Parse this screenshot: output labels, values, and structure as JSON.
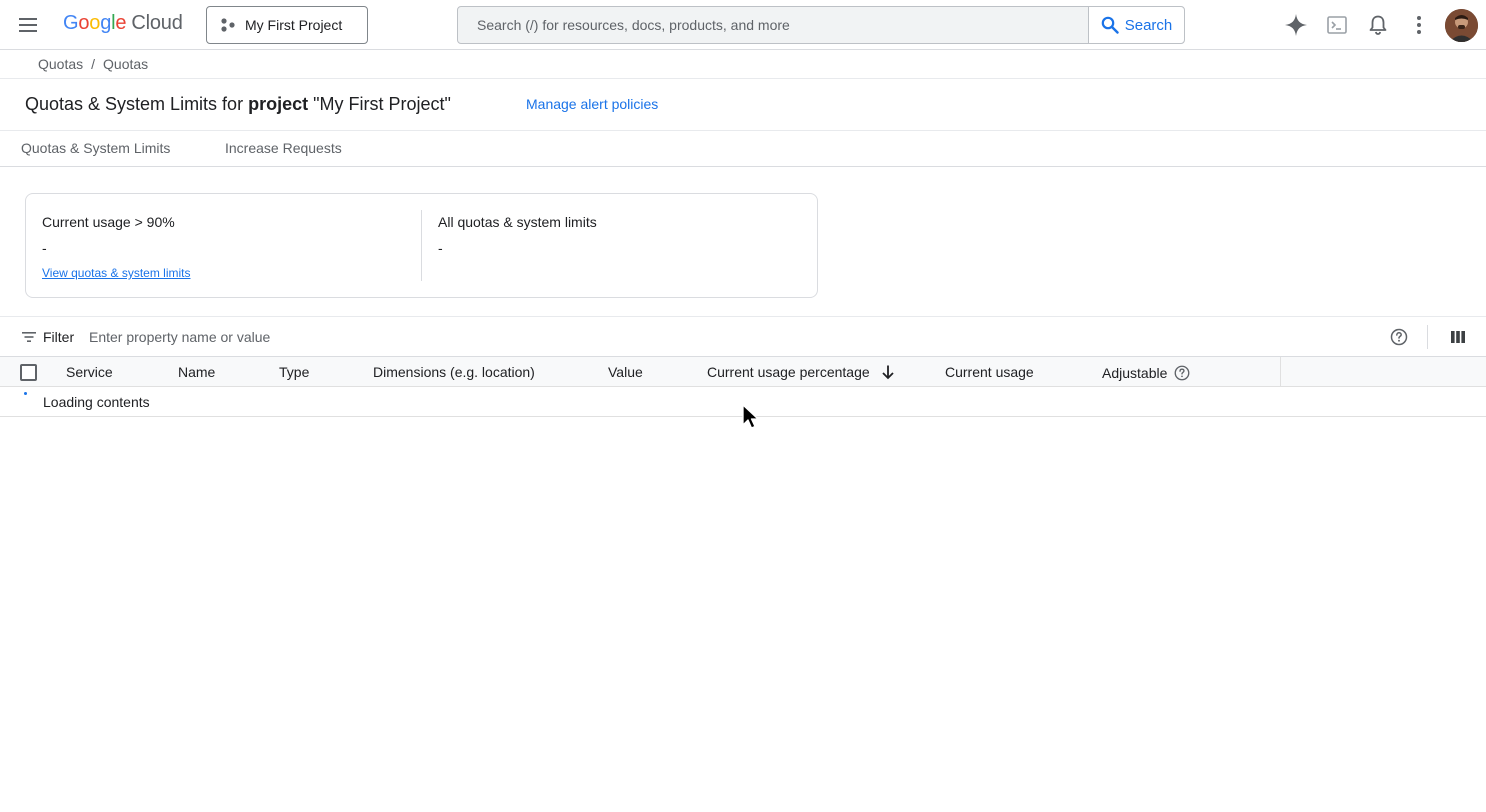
{
  "app": {
    "logo_google": [
      "G",
      "o",
      "o",
      "g",
      "l",
      "e"
    ],
    "logo_cloud": "Cloud",
    "project_name": "My First Project",
    "search_placeholder": "Search (/) for resources, docs, products, and more",
    "search_button": "Search",
    "icons": [
      "menu-icon",
      "project-icon",
      "search-icon",
      "gemini-icon",
      "cloud-shell-icon",
      "notifications-icon",
      "more-vert-icon"
    ]
  },
  "breadcrumb": {
    "items": [
      "Quotas",
      "Quotas"
    ],
    "separator": "/"
  },
  "header": {
    "title_prefix": "Quotas & System Limits for ",
    "title_bold": "project",
    "title_suffix": " \"My First Project\"",
    "manage_alert_policies": "Manage alert policies"
  },
  "tabs": [
    {
      "label": "Quotas & System Limits"
    },
    {
      "label": "Increase Requests"
    }
  ],
  "summary": {
    "high_usage": {
      "title": "Current usage > 90%",
      "value": "-",
      "link": "View quotas & system limits"
    },
    "all_quotas": {
      "title": "All quotas & system limits",
      "value": "-"
    }
  },
  "filter": {
    "label": "Filter",
    "placeholder": "Enter property name or value"
  },
  "table": {
    "columns": [
      "Service",
      "Name",
      "Type",
      "Dimensions (e.g. location)",
      "Value",
      "Current usage percentage",
      "Current usage",
      "Adjustable"
    ],
    "sorted_column": "Current usage percentage",
    "sort_direction": "descending",
    "loading_text": "Loading contents"
  },
  "colors": {
    "accent": "#1a73e8",
    "text": "#202124",
    "muted": "#5f6368",
    "border": "#dadce0"
  }
}
